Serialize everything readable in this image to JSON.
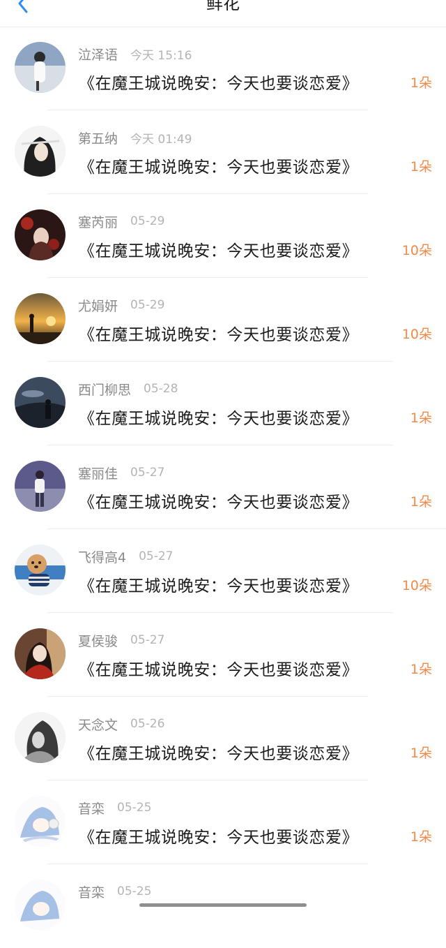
{
  "header": {
    "title": "鲜花",
    "back_icon": "chevron-left-icon",
    "accent": "#2f8ef4"
  },
  "colors": {
    "amount": "#ef8a4a",
    "name": "#8a8a8a",
    "time": "#b4b4b4"
  },
  "items": [
    {
      "name": "泣泽语",
      "time": "今天 15:16",
      "book": "《在魔王城说晚安：今天也要谈恋爱》",
      "amount": "1朵",
      "avatar": "avatar-photo-icon"
    },
    {
      "name": "第五纳",
      "time": "今天 01:49",
      "book": "《在魔王城说晚安：今天也要谈恋爱》",
      "amount": "1朵",
      "avatar": "avatar-illustration-icon"
    },
    {
      "name": "塞芮丽",
      "time": "05-29",
      "book": "《在魔王城说晚安：今天也要谈恋爱》",
      "amount": "10朵",
      "avatar": "avatar-illustration-icon"
    },
    {
      "name": "尤娟妍",
      "time": "05-29",
      "book": "《在魔王城说晚安：今天也要谈恋爱》",
      "amount": "10朵",
      "avatar": "avatar-photo-icon"
    },
    {
      "name": "西门柳思",
      "time": "05-28",
      "book": "《在魔王城说晚安：今天也要谈恋爱》",
      "amount": "1朵",
      "avatar": "avatar-photo-icon"
    },
    {
      "name": "塞丽佳",
      "time": "05-27",
      "book": "《在魔王城说晚安：今天也要谈恋爱》",
      "amount": "1朵",
      "avatar": "avatar-photo-icon"
    },
    {
      "name": "飞得高4",
      "time": "05-27",
      "book": "《在魔王城说晚安：今天也要谈恋爱》",
      "amount": "10朵",
      "avatar": "avatar-dog-icon"
    },
    {
      "name": "夏侯骏",
      "time": "05-27",
      "book": "《在魔王城说晚安：今天也要谈恋爱》",
      "amount": "1朵",
      "avatar": "avatar-photo-icon"
    },
    {
      "name": "天念文",
      "time": "05-26",
      "book": "《在魔王城说晚安：今天也要谈恋爱》",
      "amount": "1朵",
      "avatar": "avatar-photo-icon"
    },
    {
      "name": "音栾",
      "time": "05-25",
      "book": "《在魔王城说晚安：今天也要谈恋爱》",
      "amount": "1朵",
      "avatar": "avatar-illustration-icon"
    },
    {
      "name": "音栾",
      "time": "05-25",
      "book": "",
      "amount": "",
      "avatar": "avatar-illustration-icon"
    }
  ]
}
